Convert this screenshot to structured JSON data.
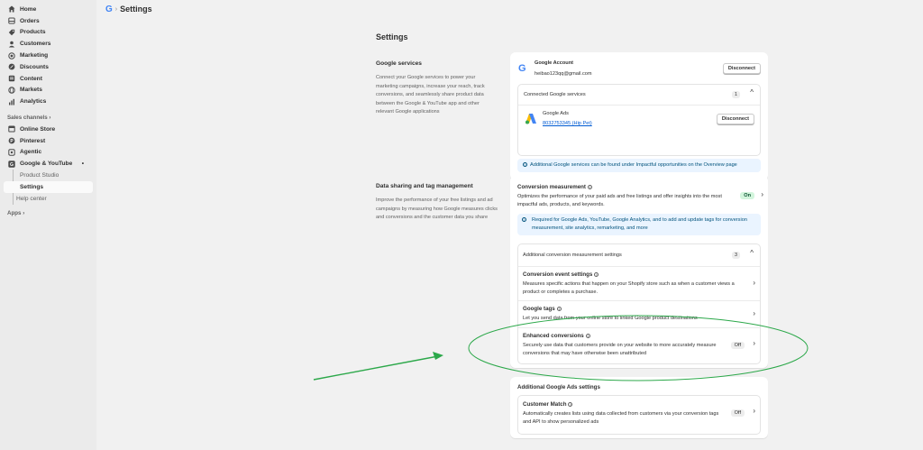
{
  "sidebar": {
    "items": [
      {
        "label": "Home",
        "icon": "home-icon"
      },
      {
        "label": "Orders",
        "icon": "orders-icon"
      },
      {
        "label": "Products",
        "icon": "tag-icon"
      },
      {
        "label": "Customers",
        "icon": "person-icon"
      },
      {
        "label": "Marketing",
        "icon": "target-icon"
      },
      {
        "label": "Discounts",
        "icon": "discount-icon"
      },
      {
        "label": "Content",
        "icon": "content-icon"
      },
      {
        "label": "Markets",
        "icon": "globe-icon"
      },
      {
        "label": "Analytics",
        "icon": "chart-icon"
      }
    ],
    "sales_channels_label": "Sales channels ›",
    "channels": [
      {
        "label": "Online Store",
        "icon": "store-icon"
      },
      {
        "label": "Pinterest",
        "icon": "pinterest-icon"
      },
      {
        "label": "Agentic",
        "icon": "agentic-icon"
      },
      {
        "label": "Google & YouTube",
        "icon": "google-icon"
      }
    ],
    "google_more": "•",
    "sub_items": [
      "Product Studio",
      "Settings",
      "Help center"
    ],
    "apps_label": "Apps ›"
  },
  "topbar": {
    "logo": "G",
    "separator": "›",
    "title": "Settings"
  },
  "page": {
    "title": "Settings"
  },
  "google_services": {
    "heading": "Google services",
    "description": "Connect your Google services to power your marketing campaigns, increase your reach, track conversions, and seamlessly share product data between the Google & YouTube app and other relevant Google applications",
    "account_label": "Google Account",
    "account_email": "heibao123qq@gmail.com",
    "disconnect_label": "Disconnect",
    "connected_label": "Connected Google services",
    "connected_count": "1",
    "ads_label": "Google Ads",
    "ads_link": "8032753345 (Hip Pet)",
    "ads_disconnect": "Disconnect",
    "info": "Additional Google services can be found under Impactful opportunities on the Overview page"
  },
  "data_sharing": {
    "heading": "Data sharing and tag management",
    "description": "Improve the performance of your free listings and ad campaigns by measuring how Google measures clicks and conversions and the customer data you share",
    "conv_title": "Conversion measurement",
    "conv_desc": "Optimizes the performance of your paid ads and free listings and offer insights into the most impactful ads, products, and keywords.",
    "conv_status": "On",
    "conv_info": "Required for Google Ads, YouTube, Google Analytics, and to add and update tags for conversion measurement, site analytics, remarketing, and more",
    "additional_label": "Additional conversion measurement settings",
    "additional_count": "3",
    "event_title": "Conversion event settings",
    "event_desc": "Measures specific actions that happen on your Shopify store such as when a customer views a product or completes a purchase.",
    "tags_title": "Google tags",
    "tags_desc": "Let you send data from your online store to linked Google product destinations",
    "enhanced_title": "Enhanced conversions",
    "enhanced_desc": "Securely use data that customers provide on your website to more accurately measure conversions that may have otherwise been unattributed",
    "enhanced_status": "Off"
  },
  "ads_settings": {
    "heading": "Additional Google Ads settings",
    "match_title": "Customer Match",
    "match_desc": "Automatically creates lists using data collected from customers via your conversion tags and API to show personalized ads",
    "match_status": "Off"
  },
  "colors": {
    "annotation": "#2ca84a",
    "accent_blue": "#005bd3"
  }
}
